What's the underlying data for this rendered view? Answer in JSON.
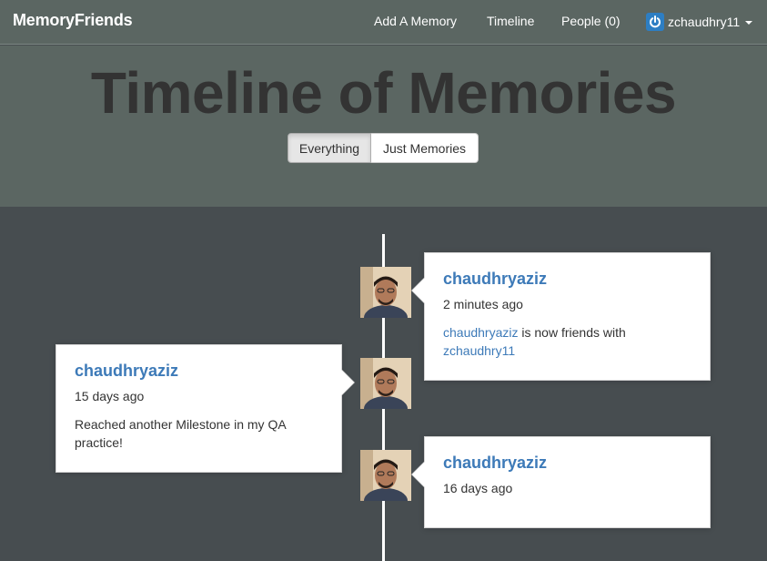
{
  "navbar": {
    "brand": "MemoryFriends",
    "links": [
      "Add A Memory",
      "Timeline",
      "People (0)"
    ],
    "user": "zchaudhry11",
    "power_icon": "power-icon",
    "dropdown_icon": "caret-down-icon"
  },
  "header": {
    "title": "Timeline of Memories",
    "filters": [
      {
        "label": "Everything",
        "active": true
      },
      {
        "label": "Just Memories",
        "active": false
      }
    ]
  },
  "timeline": {
    "items": [
      {
        "side": "right",
        "author": "chaudhryaziz",
        "time": "2 minutes ago",
        "body_link1": "chaudhryaziz",
        "body_text": " is now friends with ",
        "body_link2": "zchaudhry11"
      },
      {
        "side": "left",
        "author": "chaudhryaziz",
        "time": "15 days ago",
        "body_text": "Reached another Milestone in my QA practice!"
      },
      {
        "side": "right",
        "author": "chaudhryaziz",
        "time": "16 days ago"
      }
    ]
  },
  "colors": {
    "navbar_bg": "#5b6662",
    "page_bg": "#474d50",
    "link": "#3d7ab8",
    "power_icon_bg": "#2d7ec3"
  }
}
